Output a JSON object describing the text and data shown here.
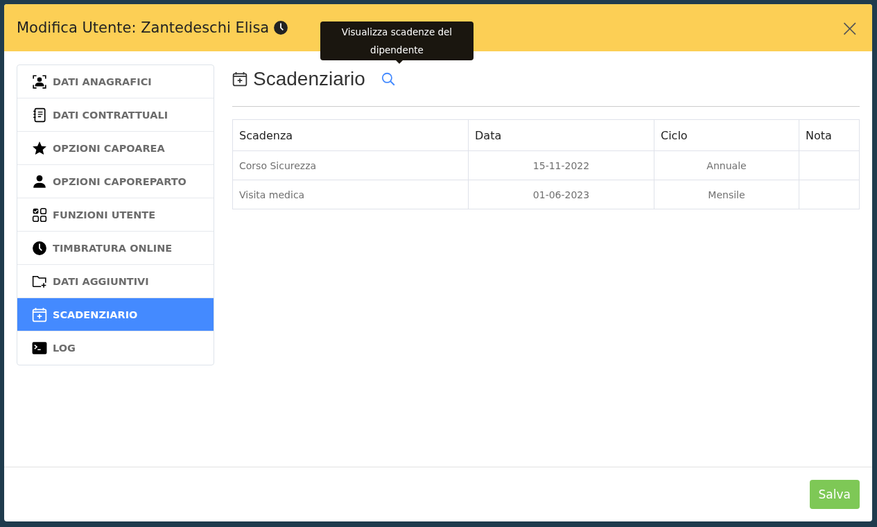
{
  "modal": {
    "title": "Modifica Utente: Zantedeschi Elisa",
    "close": "×"
  },
  "tooltip": {
    "text": "Visualizza scadenze del dipendente"
  },
  "sidebar": {
    "items": [
      {
        "label": "DATI ANAGRAFICI",
        "selected": false
      },
      {
        "label": "DATI CONTRATTUALI",
        "selected": false
      },
      {
        "label": "OPZIONI CAPOAREA",
        "selected": false
      },
      {
        "label": "OPZIONI CAPOREPARTO",
        "selected": false
      },
      {
        "label": "FUNZIONI UTENTE",
        "selected": false
      },
      {
        "label": "TIMBRATURA ONLINE",
        "selected": false
      },
      {
        "label": "DATI AGGIUNTIVI",
        "selected": false
      },
      {
        "label": "SCADENZIARIO",
        "selected": true
      },
      {
        "label": "LOG",
        "selected": false
      }
    ]
  },
  "section": {
    "title": "Scadenziario"
  },
  "table": {
    "columns": [
      "Scadenza",
      "Data",
      "Ciclo",
      "Nota"
    ],
    "rows": [
      [
        "Corso Sicurezza",
        "15-11-2022",
        "Annuale",
        ""
      ],
      [
        "Visita medica",
        "01-06-2023",
        "Mensile",
        ""
      ]
    ]
  },
  "footer": {
    "buttons": [
      "Salva"
    ]
  }
}
